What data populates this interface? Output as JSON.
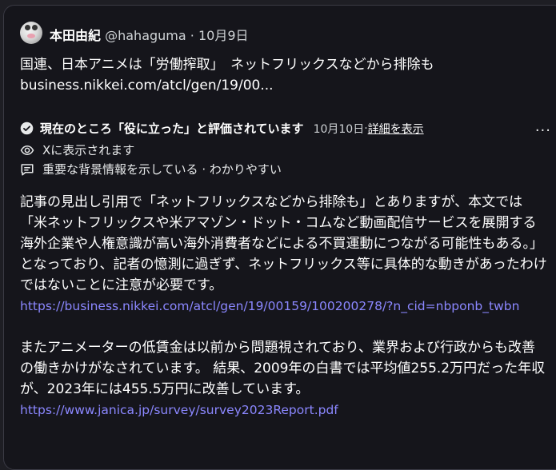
{
  "author": {
    "name": "本田由紀",
    "handle": "@hahaguma",
    "separator": " · ",
    "date": "10月9日"
  },
  "tweet": {
    "line1": "国連、日本アニメは「労働搾取」　ネットフリックスなどから排除も",
    "line2": "business.nikkei.com/atcl/gen/19/00..."
  },
  "note": {
    "status": "現在のところ「役に立った」と評価されています",
    "date": "10月10日",
    "sep": " · ",
    "details_link": "詳細を表示",
    "more_label": "···",
    "shown_on": "Xに表示されます",
    "tags": "重要な背景情報を示している · わかりやすい",
    "paragraph1": "記事の見出し引用で「ネットフリックスなどから排除も」とありますが、本文では「米ネットフリックスや米アマゾン・ドット・コムなど動画配信サービスを展開する海外企業や人権意識が高い海外消費者などによる不買運動につながる可能性もある。」となっており、記者の憶測に過ぎず、ネットフリックス等に具体的な動きがあったわけではないことに注意が必要です。",
    "url1": "https://business.nikkei.com/atcl/gen/19/00159/100200278/?n_cid=nbponb_twbn",
    "paragraph2": "またアニメーターの低賃金は以前から問題視されており、業界および行政からも改善の働きかけがなされています。 結果、2009年の白書では平均値255.2万円だった年収が、2023年には455.5万円に改善しています。",
    "url2": "https://www.janica.jp/survey/survey2023Report.pdf"
  },
  "colors": {
    "background": "#15151b",
    "link": "#8b87ff",
    "text": "#ffffff"
  }
}
